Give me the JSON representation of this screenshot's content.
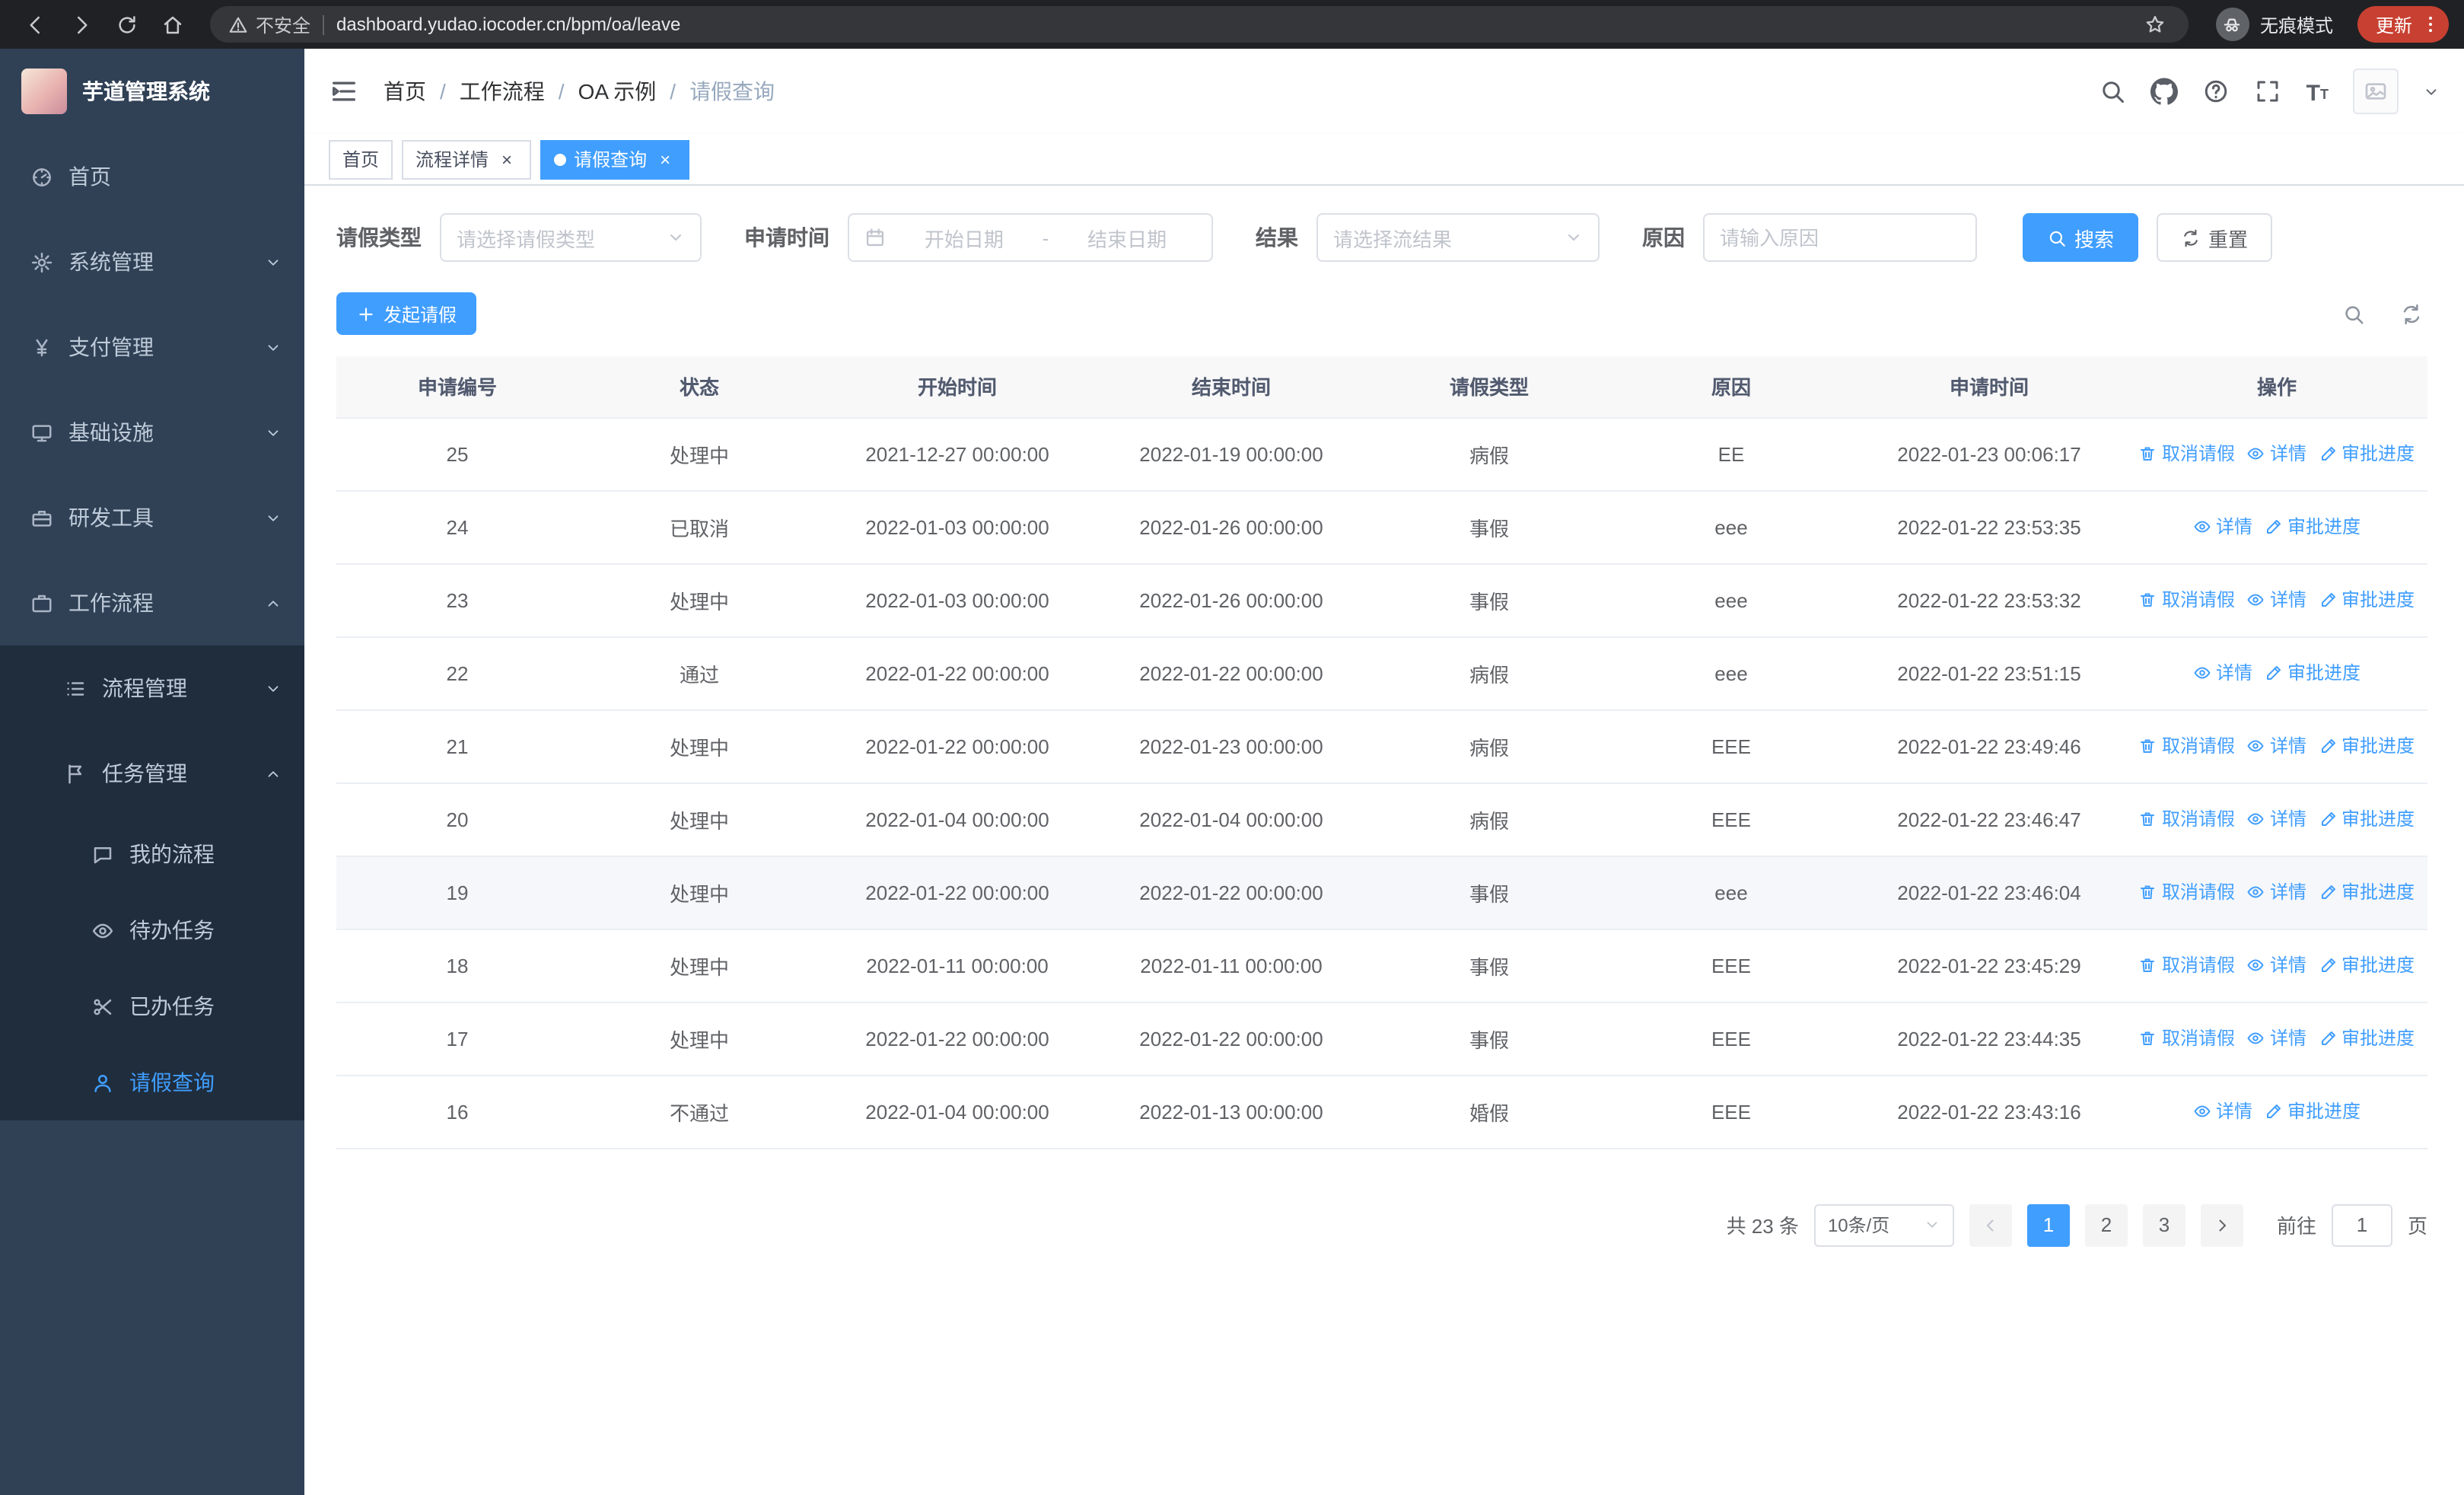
{
  "browser": {
    "security_label": "不安全",
    "url": "dashboard.yudao.iocoder.cn/bpm/oa/leave",
    "incognito_label": "无痕模式",
    "update_label": "更新"
  },
  "sidebar": {
    "title": "芋道管理系统",
    "menu": [
      {
        "key": "home",
        "label": "首页",
        "icon": "dashboard",
        "level": 1
      },
      {
        "key": "system",
        "label": "系统管理",
        "icon": "gear",
        "level": 1,
        "chevron": "down"
      },
      {
        "key": "payment",
        "label": "支付管理",
        "icon": "yen",
        "level": 1,
        "chevron": "down"
      },
      {
        "key": "infrastructure",
        "label": "基础设施",
        "icon": "monitor",
        "level": 1,
        "chevron": "down"
      },
      {
        "key": "devtools",
        "label": "研发工具",
        "icon": "toolbox",
        "level": 1,
        "chevron": "down"
      },
      {
        "key": "workflow",
        "label": "工作流程",
        "icon": "briefcase",
        "level": 1,
        "chevron": "up"
      },
      {
        "key": "process-mgmt",
        "label": "流程管理",
        "icon": "list",
        "level": 2,
        "chevron": "down"
      },
      {
        "key": "task-mgmt",
        "label": "任务管理",
        "icon": "flag",
        "level": 2,
        "chevron": "up"
      },
      {
        "key": "my-process",
        "label": "我的流程",
        "icon": "chat",
        "level": 3
      },
      {
        "key": "todo-task",
        "label": "待办任务",
        "icon": "eye",
        "level": 3
      },
      {
        "key": "done-task",
        "label": "已办任务",
        "icon": "scissors",
        "level": 3
      },
      {
        "key": "leave-query",
        "label": "请假查询",
        "icon": "user",
        "level": 3,
        "active": true
      }
    ]
  },
  "navbar": {
    "breadcrumb": [
      {
        "label": "首页"
      },
      {
        "label": "工作流程"
      },
      {
        "label": "OA 示例"
      },
      {
        "label": "请假查询",
        "current": true
      }
    ]
  },
  "tags": [
    {
      "key": "home",
      "label": "首页"
    },
    {
      "key": "process-detail",
      "label": "流程详情",
      "closable": true
    },
    {
      "key": "leave-query",
      "label": "请假查询",
      "closable": true,
      "active": true
    }
  ],
  "filters": {
    "leave_type_label": "请假类型",
    "leave_type_placeholder": "请选择请假类型",
    "apply_time_label": "申请时间",
    "start_date_placeholder": "开始日期",
    "range_separator": "-",
    "end_date_placeholder": "结束日期",
    "result_label": "结果",
    "result_placeholder": "请选择流结果",
    "reason_label": "原因",
    "reason_placeholder": "请输入原因",
    "search_label": "搜索",
    "reset_label": "重置"
  },
  "toolbar": {
    "create_label": "发起请假"
  },
  "table": {
    "columns": [
      "申请编号",
      "状态",
      "开始时间",
      "结束时间",
      "请假类型",
      "原因",
      "申请时间",
      "操作"
    ],
    "action_labels": {
      "cancel": "取消请假",
      "detail": "详情",
      "progress": "审批进度"
    },
    "action_icons": {
      "cancel": "trash",
      "detail": "eye",
      "progress": "edit"
    },
    "rows": [
      {
        "id": "25",
        "status": "处理中",
        "start_time": "2021-12-27 00:00:00",
        "end_time": "2022-01-19 00:00:00",
        "leave_type": "病假",
        "reason": "EE",
        "apply_time": "2022-01-23 00:06:17",
        "actions": [
          "cancel",
          "detail",
          "progress"
        ]
      },
      {
        "id": "24",
        "status": "已取消",
        "start_time": "2022-01-03 00:00:00",
        "end_time": "2022-01-26 00:00:00",
        "leave_type": "事假",
        "reason": "eee",
        "apply_time": "2022-01-22 23:53:35",
        "actions": [
          "detail",
          "progress"
        ]
      },
      {
        "id": "23",
        "status": "处理中",
        "start_time": "2022-01-03 00:00:00",
        "end_time": "2022-01-26 00:00:00",
        "leave_type": "事假",
        "reason": "eee",
        "apply_time": "2022-01-22 23:53:32",
        "actions": [
          "cancel",
          "detail",
          "progress"
        ]
      },
      {
        "id": "22",
        "status": "通过",
        "start_time": "2022-01-22 00:00:00",
        "end_time": "2022-01-22 00:00:00",
        "leave_type": "病假",
        "reason": "eee",
        "apply_time": "2022-01-22 23:51:15",
        "actions": [
          "detail",
          "progress"
        ]
      },
      {
        "id": "21",
        "status": "处理中",
        "start_time": "2022-01-22 00:00:00",
        "end_time": "2022-01-23 00:00:00",
        "leave_type": "病假",
        "reason": "EEE",
        "apply_time": "2022-01-22 23:49:46",
        "actions": [
          "cancel",
          "detail",
          "progress"
        ]
      },
      {
        "id": "20",
        "status": "处理中",
        "start_time": "2022-01-04 00:00:00",
        "end_time": "2022-01-04 00:00:00",
        "leave_type": "病假",
        "reason": "EEE",
        "apply_time": "2022-01-22 23:46:47",
        "actions": [
          "cancel",
          "detail",
          "progress"
        ]
      },
      {
        "id": "19",
        "status": "处理中",
        "start_time": "2022-01-22 00:00:00",
        "end_time": "2022-01-22 00:00:00",
        "leave_type": "事假",
        "reason": "eee",
        "apply_time": "2022-01-22 23:46:04",
        "actions": [
          "cancel",
          "detail",
          "progress"
        ],
        "highlighted": true
      },
      {
        "id": "18",
        "status": "处理中",
        "start_time": "2022-01-11 00:00:00",
        "end_time": "2022-01-11 00:00:00",
        "leave_type": "事假",
        "reason": "EEE",
        "apply_time": "2022-01-22 23:45:29",
        "actions": [
          "cancel",
          "detail",
          "progress"
        ]
      },
      {
        "id": "17",
        "status": "处理中",
        "start_time": "2022-01-22 00:00:00",
        "end_time": "2022-01-22 00:00:00",
        "leave_type": "事假",
        "reason": "EEE",
        "apply_time": "2022-01-22 23:44:35",
        "actions": [
          "cancel",
          "detail",
          "progress"
        ]
      },
      {
        "id": "16",
        "status": "不通过",
        "start_time": "2022-01-04 00:00:00",
        "end_time": "2022-01-13 00:00:00",
        "leave_type": "婚假",
        "reason": "EEE",
        "apply_time": "2022-01-22 23:43:16",
        "actions": [
          "detail",
          "progress"
        ]
      }
    ]
  },
  "pagination": {
    "total_label": "共 23 条",
    "page_size_label": "10条/页",
    "pages": [
      "1",
      "2",
      "3"
    ],
    "active_page": "1",
    "goto_label": "前往",
    "goto_value": "1",
    "unit_label": "页"
  }
}
